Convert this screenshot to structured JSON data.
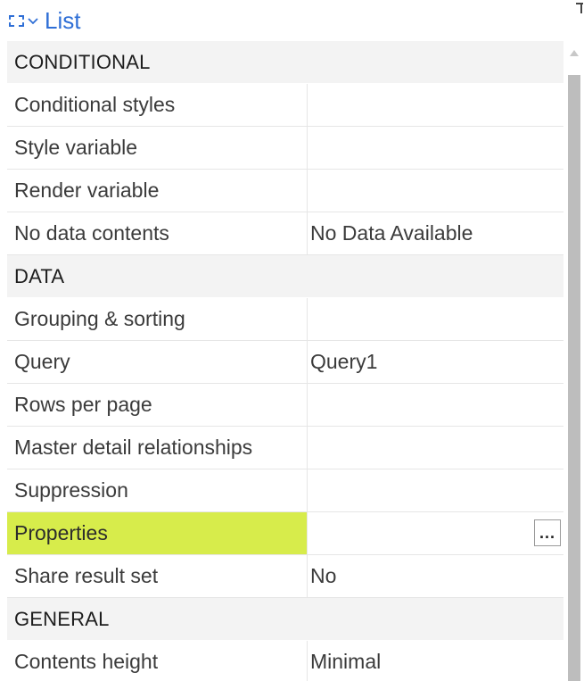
{
  "header": {
    "title": "List",
    "select_icon": "select-dashed-rect-icon",
    "dropdown_icon": "chevron-down-icon",
    "pin_icon": "pin-icon"
  },
  "sections": [
    {
      "label": "CONDITIONAL",
      "rows": [
        {
          "name": "Conditional styles",
          "value": ""
        },
        {
          "name": "Style variable",
          "value": ""
        },
        {
          "name": "Render variable",
          "value": ""
        },
        {
          "name": "No data contents",
          "value": "No Data Available"
        }
      ]
    },
    {
      "label": "DATA",
      "rows": [
        {
          "name": "Grouping & sorting",
          "value": ""
        },
        {
          "name": "Query",
          "value": "Query1"
        },
        {
          "name": "Rows per page",
          "value": ""
        },
        {
          "name": "Master detail relationships",
          "value": ""
        },
        {
          "name": "Suppression",
          "value": ""
        },
        {
          "name": "Properties",
          "value": "",
          "button": "..."
        },
        {
          "name": "Share result set",
          "value": "No"
        }
      ]
    },
    {
      "label": "GENERAL",
      "rows": [
        {
          "name": "Contents height",
          "value": "Minimal"
        }
      ]
    }
  ],
  "colors": {
    "accent": "#2f6fd6",
    "highlight": "#d7ec4b",
    "section_bg": "#f3f3f3",
    "scrollbar_thumb": "#bdbdbd"
  }
}
